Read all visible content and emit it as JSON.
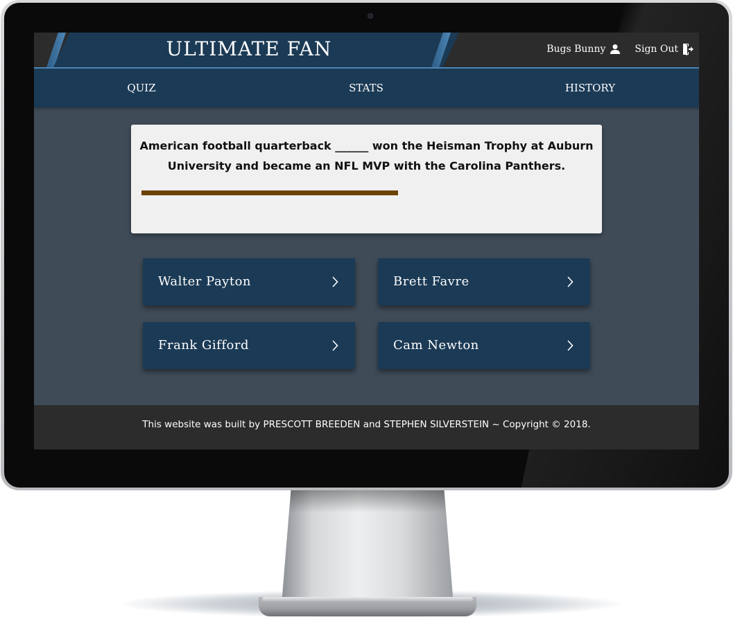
{
  "header": {
    "brand": "ULTIMATE FAN",
    "user_name": "Bugs Bunny",
    "sign_out": "Sign Out"
  },
  "nav": {
    "items": [
      {
        "label": "QUIZ"
      },
      {
        "label": "STATS"
      },
      {
        "label": "HISTORY"
      }
    ]
  },
  "question": {
    "text": "American football quarterback ______ won the Heisman Trophy at Auburn University and became an NFL MVP with the Carolina Panthers.",
    "timer_progress": 0.57
  },
  "answers": [
    {
      "label": "Walter Payton"
    },
    {
      "label": "Brett Favre"
    },
    {
      "label": "Frank Gifford"
    },
    {
      "label": "Cam Newton"
    }
  ],
  "footer": {
    "text": "This website was built by PRESCOTT BREEDEN and STEPHEN SILVERSTEIN ~ Copyright © 2018."
  },
  "colors": {
    "navy": "#1b3a55",
    "accent_blue": "#4d86b5",
    "page_bg": "#3f4c58",
    "bar_dark": "#2c2c2c",
    "timer": "#6b4206",
    "card": "#f0f0f0"
  },
  "icons": {
    "user": "person-icon",
    "sign_out": "sign-out-icon",
    "answer_arrow": "chevron-right-icon"
  }
}
